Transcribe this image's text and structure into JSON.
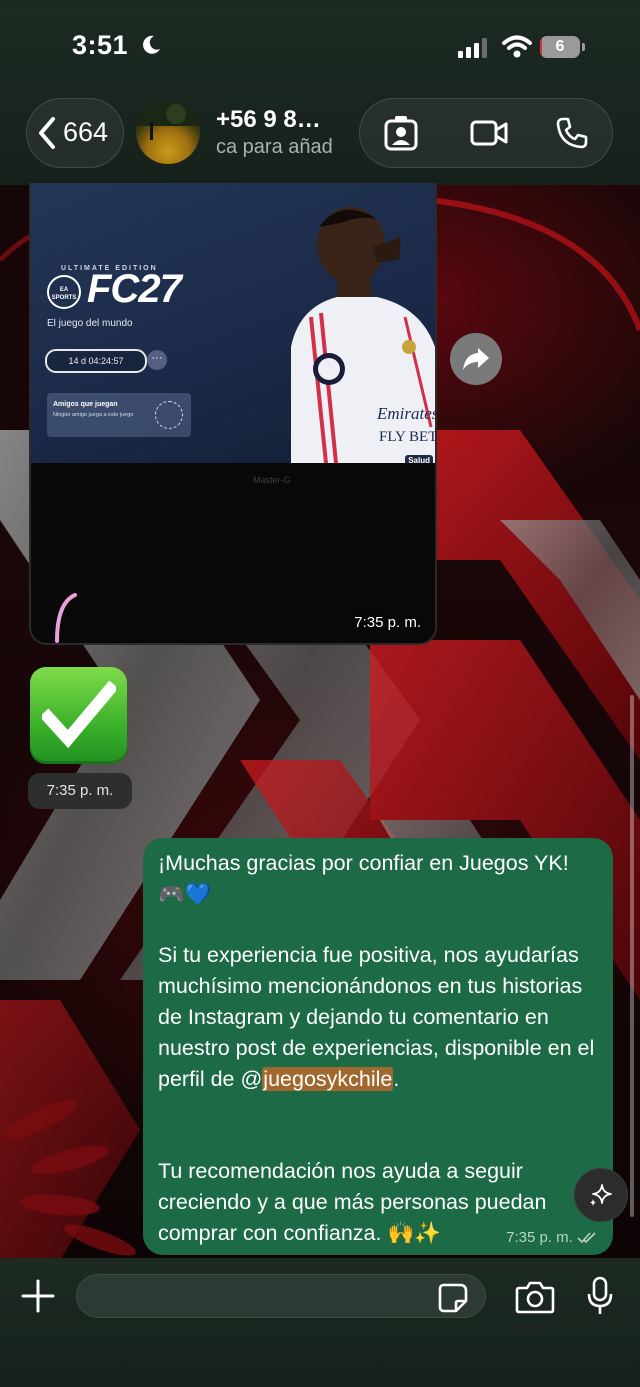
{
  "status_bar": {
    "time": "3:51",
    "battery_level": "6",
    "icons": [
      "moon-icon",
      "signal-icon",
      "wifi-icon",
      "battery-icon"
    ]
  },
  "header": {
    "back_count": "664",
    "contact_name": "+56 9 8…",
    "contact_subtitle": "ca para añad",
    "icons": [
      "contact-card-icon",
      "video-call-icon",
      "phone-icon"
    ]
  },
  "image_message": {
    "screenshot": {
      "edition": "ULTIMATE EDITION",
      "ea_label": "EA SPORTS",
      "game_title": "FC27",
      "tagline": "El juego del mundo",
      "timer": "14 d 04:24:57",
      "more": "···",
      "friends_title": "Amigos que juegan",
      "friends_subtitle": "Ningún amigo juega a este juego",
      "sponsor": "Emirates FLY BETTER",
      "badge": "Salud",
      "watermark": "Master-G"
    },
    "time": "7:35 p. m."
  },
  "sticker_message": {
    "emoji": "✅",
    "time": "7:35 p. m."
  },
  "text_message": {
    "paragraph1": "¡Muchas gracias por confiar en Juegos YK! 🎮💙",
    "paragraph2_before": "Si tu experiencia fue positiva, nos ayudarías muchísimo mencionándonos en tus historias de Instagram y dejando tu comentario en nuestro post de experiencias, disponible en el perfil de @",
    "mention": "juegosykchile",
    "paragraph2_after": ".",
    "paragraph3": "Tu recomendación nos ayuda a seguir creciendo y a que más personas puedan comprar con confianza. 🙌✨",
    "time": "7:35 p. m."
  },
  "input_bar": {
    "placeholder": ""
  },
  "colors": {
    "header_bg": "#1c2a22",
    "outgoing_bubble": "#1c6a46",
    "mention_highlight": "#a0682e",
    "battery_red": "#e0303a"
  }
}
